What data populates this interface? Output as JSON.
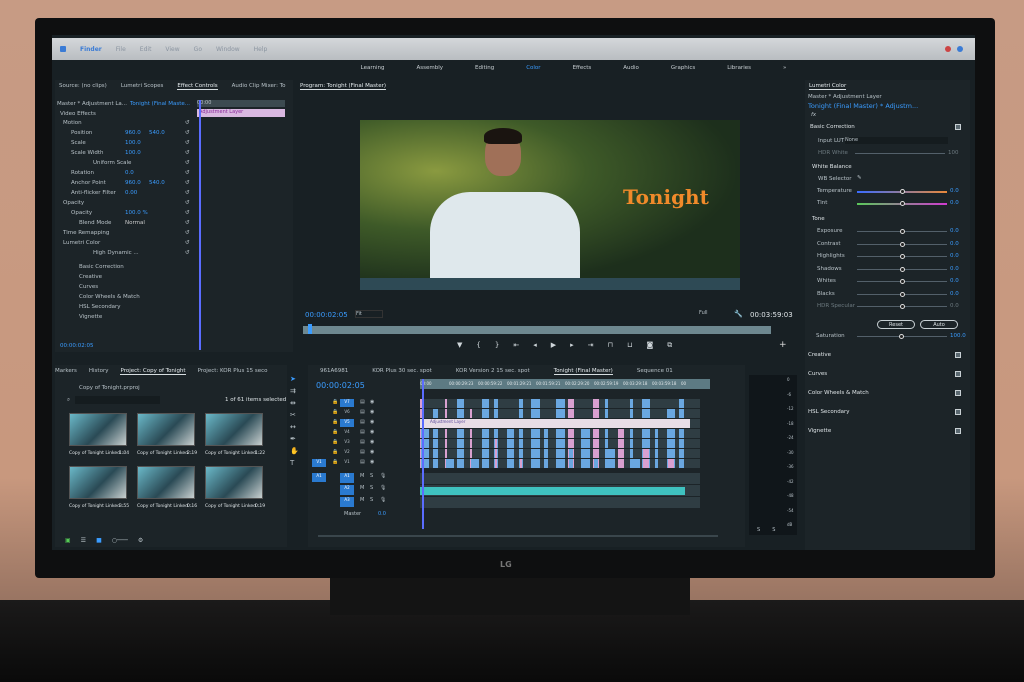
{
  "menubar": {
    "items": [
      "Finder",
      "File",
      "Edit",
      "View",
      "Go",
      "Window",
      "Help"
    ]
  },
  "workspaces": {
    "items": [
      "Learning",
      "Assembly",
      "Editing",
      "Color",
      "Effects",
      "Audio",
      "Graphics",
      "Libraries"
    ],
    "active": "Color",
    "more": "»"
  },
  "left_tabs": [
    "Source: (no clips)",
    "Lumetri Scopes",
    "Effect Controls",
    "Audio Clip Mixer: To"
  ],
  "effect_controls": {
    "master": "Master * Adjustment La...",
    "sequence": "Tonight (Final Maste...",
    "timecode_start": "00:00",
    "clip_label": "Adjustment Layer",
    "section": "Video Effects",
    "rows": [
      {
        "label": "Motion",
        "value": "",
        "value2": ""
      },
      {
        "label": "Position",
        "value": "960.0",
        "value2": "540.0"
      },
      {
        "label": "Scale",
        "value": "100.0",
        "value2": ""
      },
      {
        "label": "Scale Width",
        "value": "100.0",
        "value2": ""
      },
      {
        "label": "Uniform Scale",
        "value": "",
        "value2": ""
      },
      {
        "label": "Rotation",
        "value": "0.0",
        "value2": ""
      },
      {
        "label": "Anchor Point",
        "value": "960.0",
        "value2": "540.0"
      },
      {
        "label": "Anti-flicker Filter",
        "value": "0.00",
        "value2": ""
      },
      {
        "label": "Opacity",
        "value": "",
        "value2": ""
      },
      {
        "label": "Opacity",
        "value": "100.0 %",
        "value2": ""
      },
      {
        "label": "Blend Mode",
        "value": "Normal",
        "value2": ""
      },
      {
        "label": "Time Remapping",
        "value": "",
        "value2": ""
      },
      {
        "label": "Lumetri Color",
        "value": "",
        "value2": ""
      },
      {
        "label": "High Dynamic ...",
        "value": "",
        "value2": ""
      },
      {
        "label": "Basic Correction",
        "value": "",
        "value2": ""
      },
      {
        "label": "Creative",
        "value": "",
        "value2": ""
      },
      {
        "label": "Curves",
        "value": "",
        "value2": ""
      },
      {
        "label": "Color Wheels & Match",
        "value": "",
        "value2": ""
      },
      {
        "label": "HSL Secondary",
        "value": "",
        "value2": ""
      },
      {
        "label": "Vignette",
        "value": "",
        "value2": ""
      }
    ],
    "timecode": "00:00:02:05"
  },
  "program": {
    "title": "Program: Tonight (Final Master)",
    "overlay_text": "Tonight",
    "timecode": "00:00:02:05",
    "fit": "Fit",
    "quality": "Full",
    "duration": "00:03:59:03",
    "playhead_fraction": 0.01
  },
  "lumetri": {
    "title": "Lumetri Color",
    "master": "Master * Adjustment Layer",
    "sequence": "Tonight (Final Master) * Adjustm...",
    "fx": "fx",
    "basic_correction": "Basic Correction",
    "input_lut_label": "Input LUT",
    "input_lut_value": "None",
    "hdr_white_label": "HDR White",
    "hdr_white_value": "100",
    "white_balance": "White Balance",
    "wb_selector": "WB Selector",
    "tone": "Tone",
    "sliders": [
      {
        "label": "Temperature",
        "value": "0.0"
      },
      {
        "label": "Tint",
        "value": "0.0"
      },
      {
        "label": "Exposure",
        "value": "0.0"
      },
      {
        "label": "Contrast",
        "value": "0.0"
      },
      {
        "label": "Highlights",
        "value": "0.0"
      },
      {
        "label": "Shadows",
        "value": "0.0"
      },
      {
        "label": "Whites",
        "value": "0.0"
      },
      {
        "label": "Blacks",
        "value": "0.0"
      },
      {
        "label": "HDR Specular",
        "value": "0.0"
      }
    ],
    "reset": "Reset",
    "auto": "Auto",
    "saturation_label": "Saturation",
    "saturation_value": "100.0",
    "sections": [
      "Creative",
      "Curves",
      "Color Wheels & Match",
      "HSL Secondary",
      "Vignette"
    ]
  },
  "project": {
    "tabs": [
      "Markers",
      "History",
      "Project: Copy of Tonight",
      "Project: KOR Plus 15 seco"
    ],
    "file": "Copy of Tonight.prproj",
    "selection": "1 of 61 items selected",
    "items": [
      {
        "name": "Copy of Tonight Linked...",
        "duration": "1:04"
      },
      {
        "name": "Copy of Tonight Linked...",
        "duration": "2:19"
      },
      {
        "name": "Copy of Tonight Linked...",
        "duration": "1:22"
      },
      {
        "name": "Copy of Tonight Linked...",
        "duration": "3:55"
      },
      {
        "name": "Copy of Tonight Linked...",
        "duration": "0:16"
      },
      {
        "name": "Copy of Tonight Linked...",
        "duration": "0:19"
      }
    ]
  },
  "timeline": {
    "tabs": [
      "961A6981",
      "KOR Plus 30 sec. spot",
      "KOR Version 2 15 sec. spot",
      "Tonight (Final Master)",
      "Sequence 01"
    ],
    "active_tab": "Tonight (Final Master)",
    "timecode": "00:00:02:05",
    "ruler": [
      "00:00",
      "00:00:29:23",
      "00:00:59:22",
      "00:01:29:21",
      "00:01:59:21",
      "00:02:29:20",
      "00:02:59:19",
      "00:03:29:18",
      "00:03:59:18",
      "00"
    ],
    "video_tracks": [
      "V7",
      "V6",
      "V5",
      "V4",
      "V3",
      "V2",
      "V1"
    ],
    "audio_tracks": [
      "A1",
      "A2",
      "A3"
    ],
    "target_video": "V1",
    "target_audio": "A1",
    "adjustment_clip": "Adjustment Layer",
    "master_label": "Master",
    "master_value": "0.0",
    "meter_ticks": [
      "0",
      "-6",
      "-12",
      "-18",
      "-24",
      "-30",
      "-36",
      "-42",
      "-48",
      "-54",
      "dB"
    ],
    "solo": [
      "S",
      "S"
    ]
  },
  "monitor_brand": "LG",
  "colors": {
    "accent": "#3a9cff",
    "adjustment": "#d9b8e0",
    "video_clip": "#6aa7e0",
    "audio_clip": "#3fc2c0"
  }
}
